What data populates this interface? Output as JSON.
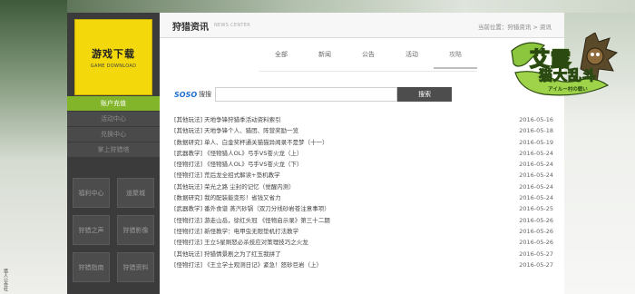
{
  "left_side_text": "猎人公会社",
  "game_download": {
    "title": "游戏下载",
    "subtitle": "GAME DOWNLOAD"
  },
  "sidebar": {
    "items": [
      {
        "label": "账户充值",
        "active": true
      },
      {
        "label": "活动中心",
        "active": false
      },
      {
        "label": "兑换中心",
        "active": false
      },
      {
        "label": "掌上狩猎塔",
        "active": false
      }
    ],
    "tiles": [
      "福利中心",
      "道聚城",
      "狩猎之声",
      "狩猎影像",
      "狩猎指南",
      "狩猎资料"
    ]
  },
  "header": {
    "title": "狩猎资讯",
    "subtitle_en": "NEWS CENTER",
    "breadcrumb": "当前位置：狩猎资讯 > 资讯"
  },
  "tabs": [
    {
      "label": "全部",
      "active": false
    },
    {
      "label": "新闻",
      "active": false
    },
    {
      "label": "公告",
      "active": false
    },
    {
      "label": "活动",
      "active": false
    },
    {
      "label": "攻略",
      "active": true
    }
  ],
  "search": {
    "logo": "SOSO",
    "label": "搜搜",
    "placeholder": "",
    "value": "",
    "button_label": "搜索"
  },
  "news": [
    {
      "title": "[其他玩法] 天地争锋狩猎季活动资料索引",
      "date": "2016-05-16"
    },
    {
      "title": "[其他玩法] 天地争锋个人、猎团、阵营奖励一览",
      "date": "2016-05-18"
    },
    {
      "title": "[数据研究] 单人、白金奖杯通关猫猫异闻录不是梦（十一）",
      "date": "2016-05-19"
    },
    {
      "title": "[武器教学] 《怪物猎人OL》弓手VS苍火龙（上）",
      "date": "2016-05-24"
    },
    {
      "title": "[怪物打法] 《怪物猎人OL》弓手VS苍火龙（下）",
      "date": "2016-05-24"
    },
    {
      "title": "[怪物打法] 荒后龙全招式解读+垫机教学",
      "date": "2016-05-24"
    },
    {
      "title": "[其他玩法] 荣光之路 尘封的记忆（觉醒内测）",
      "date": "2016-05-24"
    },
    {
      "title": "[数据研究] 我的配装能变形！省钱又省力",
      "date": "2016-05-24"
    },
    {
      "title": "[武器教学] 番外食谱 蒸汽砂锅（双刀分线砂岩苍注意事项）",
      "date": "2016-05-25"
    },
    {
      "title": "[怪物打法] 游走山岳，徐红头冠 《怪物启示录》第三十二期",
      "date": "2016-05-26"
    },
    {
      "title": "[怪物打法] 新怪教学：电甲虫无限垫机打法教学",
      "date": "2016-05-26"
    },
    {
      "title": "[怪物打法] 王立5星刷怒必杀技应对策理技巧之火龙",
      "date": "2016-05-26"
    },
    {
      "title": "[其他玩法] 狩猎情景剧之为了红玉我拼了",
      "date": "2016-05-27"
    },
    {
      "title": "[怪物打法] 《王立学士观测日记》紧急！怒砂巨岩（上）",
      "date": "2016-05-27"
    }
  ],
  "logo": {
    "line1": "艾露",
    "line2": "猫大乱斗",
    "small": "アイルー村の戦い"
  },
  "colors": {
    "accent_green": "#82b52a",
    "download_yellow": "#f3d80b",
    "sidebar_dark": "#3b3b3b",
    "search_button": "#4d4d4d"
  }
}
